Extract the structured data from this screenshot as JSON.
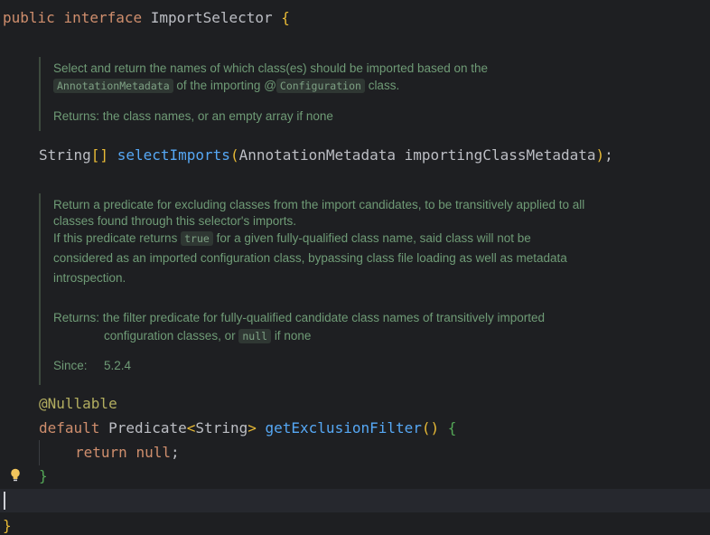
{
  "code": {
    "decl": {
      "kw1": "public",
      "kw2": "interface",
      "name": "ImportSelector",
      "brace": "{"
    },
    "method1": {
      "type": "String",
      "arr": "[]",
      "name": "selectImports",
      "lparen": "(",
      "ptype": "AnnotationMetadata",
      "pname": "importingClassMetadata",
      "rparen": ")",
      "semi": ";"
    },
    "annotation": "@Nullable",
    "method2": {
      "kw": "default",
      "type": "Predicate",
      "lt": "<",
      "gtype": "String",
      "gt": ">",
      "name": "getExclusionFilter",
      "parens": "()",
      "brace": "{"
    },
    "ret": {
      "kw": "return",
      "val": "null",
      "semi": ";"
    },
    "close_inner": "}",
    "close_outer": "}"
  },
  "doc1": {
    "l1": "Select and return the names of which class(es) should be imported based on the",
    "chip1": "AnnotationMetadata",
    "mid": "of the importing @",
    "chip2": "Configuration",
    "end": "class.",
    "returns_label": "Returns:",
    "returns_text": "the class names, or an empty array if none"
  },
  "doc2": {
    "l1": "Return a predicate for excluding classes from the import candidates, to be transitively applied to all",
    "l2": "classes found through this selector's imports.",
    "l3a": "If this predicate returns",
    "chip_true": "true",
    "l3b": "for a given fully-qualified class name, said class will not be",
    "l4": "considered as an imported configuration class, bypassing class file loading as well as metadata",
    "l5": "introspection.",
    "returns_label": "Returns:",
    "returns_l1": "the filter predicate for fully-qualified candidate class names of transitively imported",
    "returns_l2a": "configuration classes, or",
    "chip_null": "null",
    "returns_l2b": "if none",
    "since_label": "Since:",
    "since_value": "5.2.4"
  },
  "colors": {
    "background": "#1e1f22",
    "keyword": "#cf8e6d",
    "function": "#56a8f5",
    "doc": "#6f9b76"
  }
}
